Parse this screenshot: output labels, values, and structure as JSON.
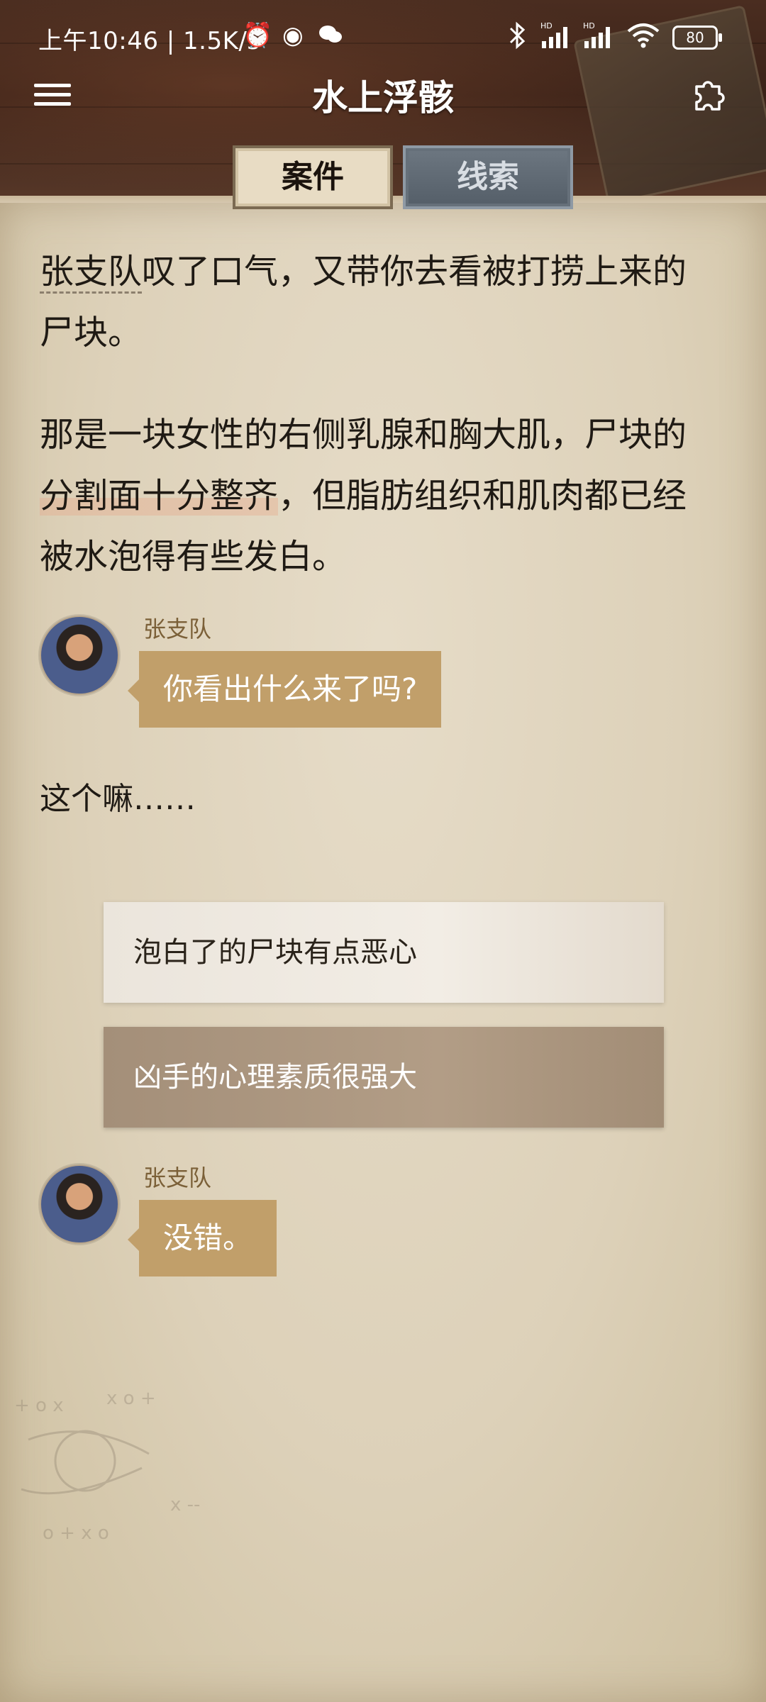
{
  "status_bar": {
    "time": "上午10:46 | 1.5K/s",
    "battery": "80"
  },
  "header": {
    "title": "水上浮骸"
  },
  "tabs": [
    {
      "label": "案件",
      "active": true
    },
    {
      "label": "线索",
      "active": false
    }
  ],
  "story": {
    "para1_name": "张支队",
    "para1_rest": "叹了口气，又带你去看被打捞上来的尸块。",
    "para2_start": "那是一块女性的右侧乳腺和胸大肌，尸块的",
    "para2_highlight": "分割面十分整齐",
    "para2_end": "，但脂肪组织和肌肉都已经被水泡得有些发白。"
  },
  "dialogue": [
    {
      "speaker": "张支队",
      "text": "你看出什么来了吗?"
    },
    {
      "speaker": "张支队",
      "text": "没错。"
    }
  ],
  "monologue": "这个嘛……",
  "choices": [
    {
      "text": "泡白了的尸块有点恶心"
    },
    {
      "text": "凶手的心理素质很强大"
    }
  ],
  "colors": {
    "bubble": "#c19f6a",
    "speaker": "#7b6038",
    "paper": "#ddd1b9"
  }
}
